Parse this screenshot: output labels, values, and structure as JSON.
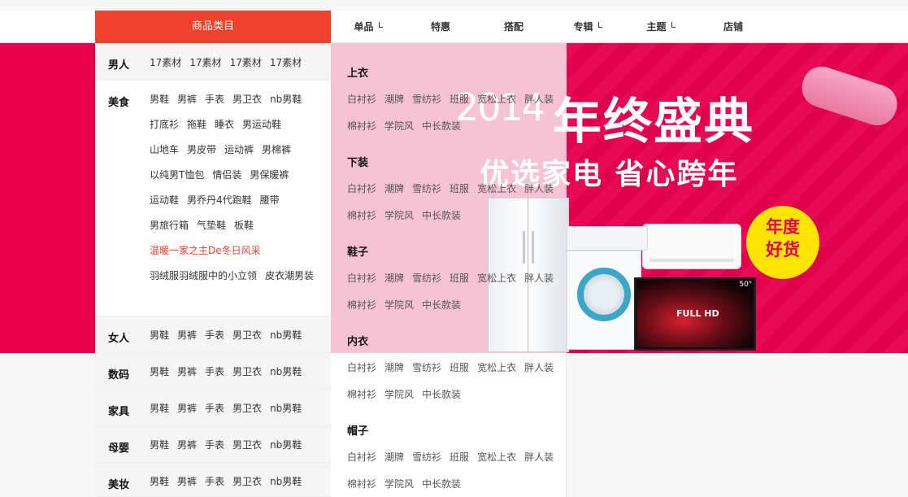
{
  "nav": {
    "category_title": "商品类目",
    "items": [
      {
        "label": "单品",
        "dropdown": true
      },
      {
        "label": "特惠",
        "dropdown": false
      },
      {
        "label": "搭配",
        "dropdown": false
      },
      {
        "label": "专辑",
        "dropdown": true
      },
      {
        "label": "主题",
        "dropdown": true
      },
      {
        "label": "店铺",
        "dropdown": false
      }
    ]
  },
  "banner": {
    "year": "2014",
    "title": "年终盛典",
    "subtitle": "优选家电  省心跨年",
    "badge_line1": "年度",
    "badge_line2": "好货",
    "tv_label": "FULL HD",
    "tv_size": "50\"",
    "colors": {
      "primary": "#e8004e",
      "badge": "#ffe400",
      "overlay": "#f7c3d4"
    }
  },
  "sidebar": {
    "categories": [
      {
        "name": "男人",
        "links": [
          "17素材",
          "17素材",
          "17素材",
          "17素材"
        ]
      },
      {
        "name": "美食",
        "links": [
          "男鞋",
          "男裤",
          "手表",
          "男卫衣",
          "nb男鞋",
          "打底衫",
          "拖鞋",
          "睡衣",
          "男运动鞋",
          "山地车",
          "男皮带",
          "运动裤",
          "男棉裤",
          "以纯男T恤包",
          "情侣装",
          "男保暖裤",
          "运动鞋",
          "男乔丹4代跑鞋",
          "腰带",
          "男旅行箱",
          "气垫鞋",
          "板鞋",
          "温暖一家之主De冬日风采",
          "羽绒服羽绒服中的小立领",
          "皮衣潮男装"
        ],
        "hot_index": 22
      },
      {
        "name": "女人",
        "links": [
          "男鞋",
          "男裤",
          "手表",
          "男卫衣",
          "nb男鞋"
        ]
      },
      {
        "name": "数码",
        "links": [
          "男鞋",
          "男裤",
          "手表",
          "男卫衣",
          "nb男鞋"
        ]
      },
      {
        "name": "家具",
        "links": [
          "男鞋",
          "男裤",
          "手表",
          "男卫衣",
          "nb男鞋"
        ]
      },
      {
        "name": "母婴",
        "links": [
          "男鞋",
          "男裤",
          "手表",
          "男卫衣",
          "nb男鞋"
        ]
      },
      {
        "name": "美妆",
        "links": [
          "男鞋",
          "男裤",
          "手表",
          "男卫衣",
          "nb男鞋"
        ]
      }
    ]
  },
  "popup": {
    "groups": [
      {
        "title": "上衣",
        "links": [
          "白衬衫",
          "潮牌",
          "雪纺衫",
          "班服",
          "宽松上衣",
          "胖人装",
          "棉衬衫",
          "学院风",
          "中长款装"
        ]
      },
      {
        "title": "下装",
        "links": [
          "白衬衫",
          "潮牌",
          "雪纺衫",
          "班服",
          "宽松上衣",
          "胖人装",
          "棉衬衫",
          "学院风",
          "中长款装"
        ]
      },
      {
        "title": "鞋子",
        "links": [
          "白衬衫",
          "潮牌",
          "雪纺衫",
          "班服",
          "宽松上衣",
          "胖人装",
          "棉衬衫",
          "学院风",
          "中长款装"
        ]
      },
      {
        "title": "内衣",
        "links": [
          "白衬衫",
          "潮牌",
          "雪纺衫",
          "班服",
          "宽松上衣",
          "胖人装",
          "棉衬衫",
          "学院风",
          "中长款装"
        ]
      },
      {
        "title": "帽子",
        "links": [
          "白衬衫",
          "潮牌",
          "雪纺衫",
          "班服",
          "宽松上衣",
          "胖人装",
          "棉衬衫",
          "学院风",
          "中长款装"
        ]
      }
    ]
  }
}
